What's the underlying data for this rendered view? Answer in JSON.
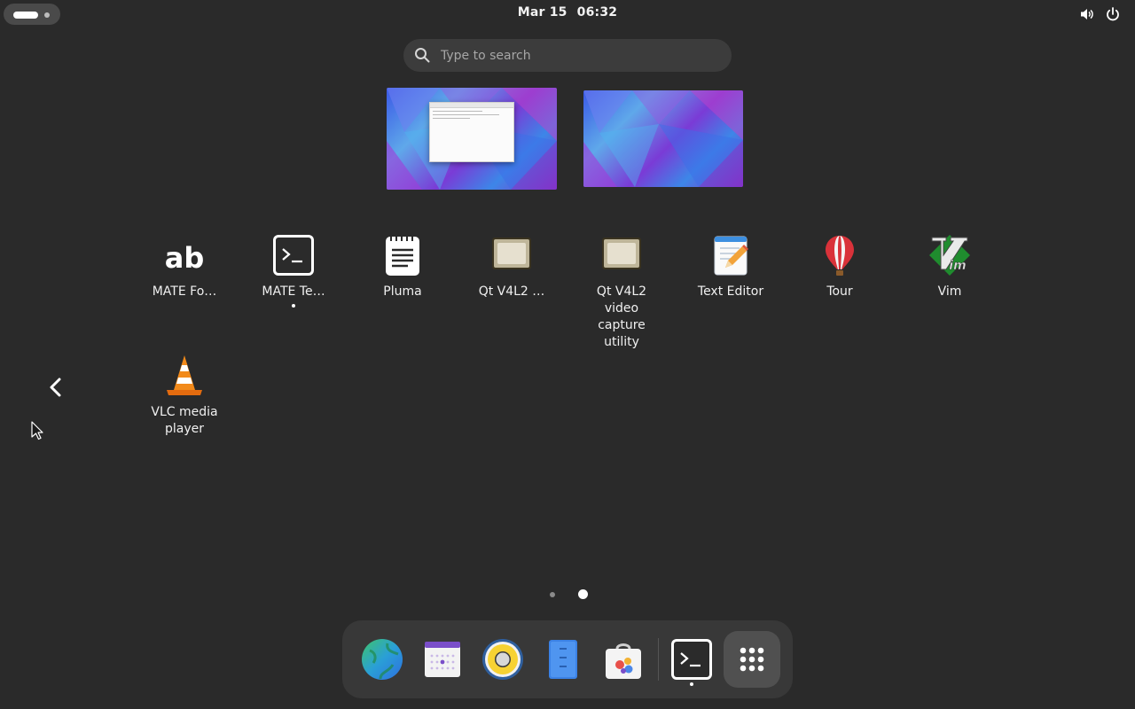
{
  "topbar": {
    "date": "Mar 15",
    "time": "06:32",
    "icons": [
      "activities-indicator",
      "volume-icon",
      "power-icon"
    ]
  },
  "search": {
    "placeholder": "Type to search"
  },
  "workspaces": [
    {
      "name": "workspace-1",
      "has_window": true
    },
    {
      "name": "workspace-2",
      "has_window": false
    }
  ],
  "apps": [
    {
      "label": "MATE Fo…",
      "icon": "font-viewer-icon",
      "running": false
    },
    {
      "label": "MATE Te…",
      "icon": "terminal-icon",
      "running": true
    },
    {
      "label": "Pluma",
      "icon": "pluma-icon",
      "running": false
    },
    {
      "label": "Qt V4L2 …",
      "icon": "qv4l2-icon",
      "running": false
    },
    {
      "label": "Qt V4L2\nvideo\ncapture\nutility",
      "icon": "qv4l2-icon",
      "running": false
    },
    {
      "label": "Text Editor",
      "icon": "text-editor-icon",
      "running": false
    },
    {
      "label": "Tour",
      "icon": "tour-balloon-icon",
      "running": false
    },
    {
      "label": "Vim",
      "icon": "vim-icon",
      "running": false
    },
    {
      "label": "VLC media\nplayer",
      "icon": "vlc-cone-icon",
      "running": false
    }
  ],
  "pager": {
    "pages": 2,
    "current": 2
  },
  "dash": {
    "items": [
      {
        "name": "web-browser",
        "icon": "globe-icon"
      },
      {
        "name": "calendar",
        "icon": "calendar-icon"
      },
      {
        "name": "rhythmbox",
        "icon": "speaker-icon"
      },
      {
        "name": "files",
        "icon": "files-icon"
      },
      {
        "name": "software",
        "icon": "software-bag-icon"
      },
      {
        "name": "terminal",
        "icon": "terminal-icon",
        "running": true
      },
      {
        "name": "show-apps",
        "icon": "app-grid-icon"
      }
    ]
  },
  "colors": {
    "background": "#2a2a2a",
    "dash": "#383838",
    "search": "#3c3c3c"
  }
}
